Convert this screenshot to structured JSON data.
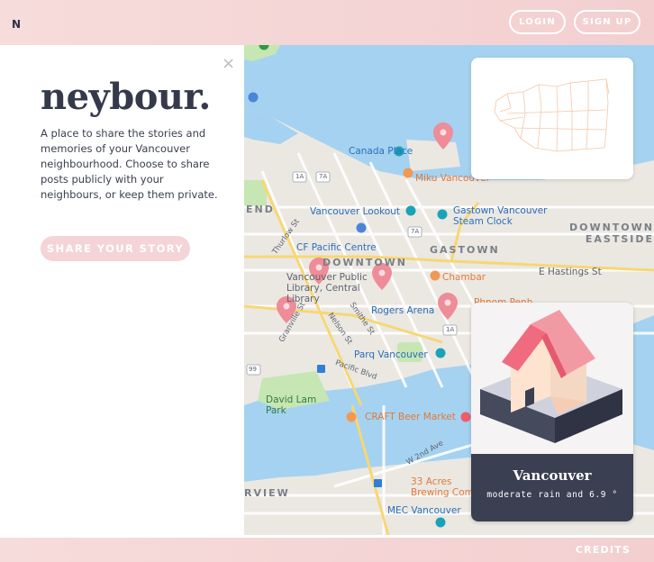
{
  "header": {
    "logo": "N",
    "login_label": "LOGIN",
    "signup_label": "SIGN UP"
  },
  "intro": {
    "close_glyph": "×",
    "title": "neybour.",
    "description": "A place to share the stories and memories of your Vancouver neighbourhood. Choose to share posts publicly with your neighbours, or keep them private.",
    "cta_label": "SHARE YOUR STORY"
  },
  "map": {
    "labels": {
      "canada_place": "Canada Place",
      "miku": "Miku Vancouver",
      "gastown_clock": "Gastown Vancouver Steam Clock",
      "vancouver_lookout": "Vancouver Lookout",
      "downtown_eastside": "DOWNTOWN EASTSIDE",
      "cf_pacific_centre": "CF Pacific Centre",
      "gastown": "GASTOWN",
      "downtown": "DOWNTOWN",
      "chambar": "Chambar",
      "public_library": "Vancouver Public Library, Central Library",
      "e_hastings": "E Hastings St",
      "rogers_arena": "Rogers Arena",
      "phnom_penh": "Phnom Penh",
      "parq": "Parq Vancouver",
      "david_lam": "David Lam Park",
      "craft_beer": "CRAFT Beer Market",
      "acres": "33 Acres Brewing Com",
      "mec": "MEC Vancouver",
      "west_end": "END",
      "fairview": "RVIEW",
      "thurlow": "Thurlow St",
      "granville": "Granville St",
      "smithe": "Smithe St",
      "nelson": "Nelson St",
      "pacific_blvd": "Pacific Blvd",
      "w2nd": "W 2nd Ave",
      "route_1a": "1A",
      "route_7a": "7A",
      "route_99": "99"
    },
    "pin_color": "#ee8c97",
    "water_color": "#a5d2f0",
    "park_color": "#c6e6b4"
  },
  "weather": {
    "city": "Vancouver",
    "condition": "moderate rain and 6.9 °"
  },
  "footer": {
    "credits_label": "CREDITS"
  },
  "colors": {
    "accent_pink": "#f3cfd0",
    "dark_navy": "#3b3f52",
    "roof_red": "#f06b7f"
  }
}
